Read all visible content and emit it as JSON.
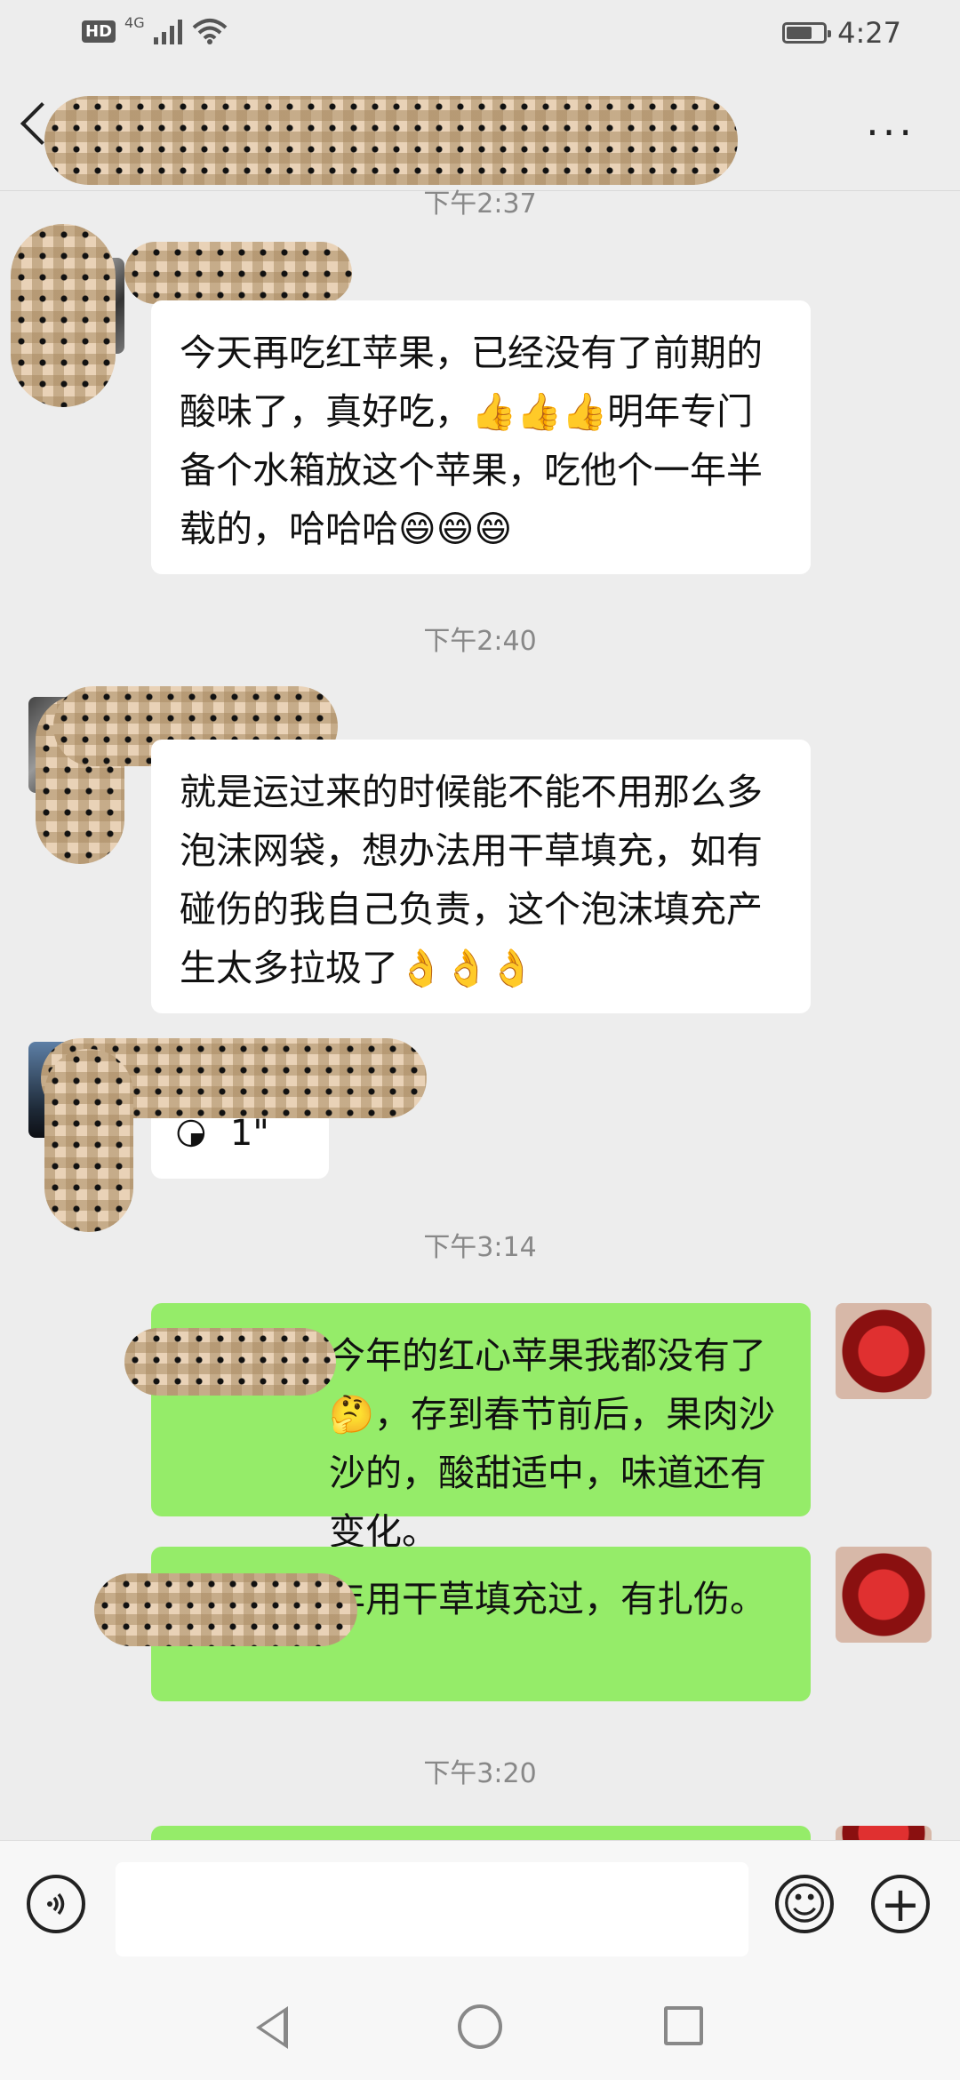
{
  "status_bar": {
    "hd": "HD",
    "network": "4G",
    "time": "4:27"
  },
  "header": {
    "more_label": "···"
  },
  "messages": [
    {
      "time": "下午2:37",
      "text": "今天再吃红苹果，已经没有了前期的酸味了，真好吃，👍👍👍明年专门备个水箱放这个苹果，吃他个一年半载的，哈哈哈😄😄😄"
    },
    {
      "time": "下午2:40",
      "text": "就是运过来的时候能不能不用那么多泡沫网袋，想办法用干草填充，如有碰伤的我自己负责，这个泡沫填充产生太多拉圾了👌👌👌"
    },
    {
      "voice_duration": "1\""
    },
    {
      "time": "下午3:14",
      "text": "今年的红心苹果我都没有了🤔，存到春节前后，果肉沙沙的，酸甜适中，味道还有变化。"
    },
    {
      "text": "年用干草填充过，有扎伤。"
    },
    {
      "time": "下午3:20"
    }
  ],
  "input": {
    "emoji_icon": "☺",
    "plus_icon": "+"
  },
  "colors": {
    "background": "#ededed",
    "incoming_bubble": "#ffffff",
    "outgoing_bubble": "#95ec69"
  }
}
